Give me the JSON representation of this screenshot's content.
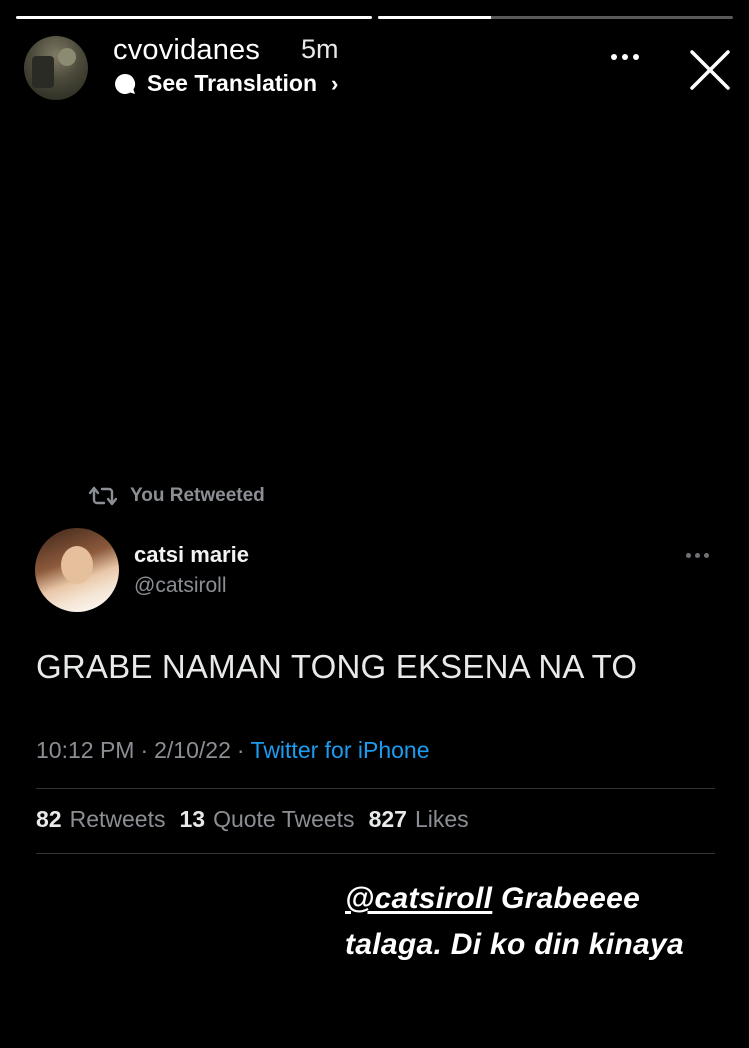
{
  "story": {
    "progress": [
      1.0,
      0.32
    ],
    "username": "cvovidanes",
    "time_ago": "5m",
    "translation_label": "See Translation"
  },
  "tweet": {
    "retweet_label": "You Retweeted",
    "name": "catsi marie",
    "handle": "@catsiroll",
    "text": "GRABE NAMAN TONG EKSENA NA TO",
    "time": "10:12 PM",
    "date": "2/10/22",
    "source": "Twitter for iPhone",
    "separator": "·",
    "stats": {
      "retweets": "82",
      "retweets_label": "Retweets",
      "quotes": "13",
      "quotes_label": "Quote Tweets",
      "likes": "827",
      "likes_label": "Likes"
    }
  },
  "caption": {
    "mention": "@catsiroll",
    "line1_rest": " Grabeeee",
    "line2": "talaga. Di ko din kinaya"
  },
  "colors": {
    "background": "#000000",
    "muted_text": "#8b8f94",
    "link_blue": "#1d9bf0"
  },
  "icons": [
    "chat-bubble-icon",
    "chevron-right-icon",
    "more-options-icon",
    "close-icon",
    "retweet-icon"
  ]
}
